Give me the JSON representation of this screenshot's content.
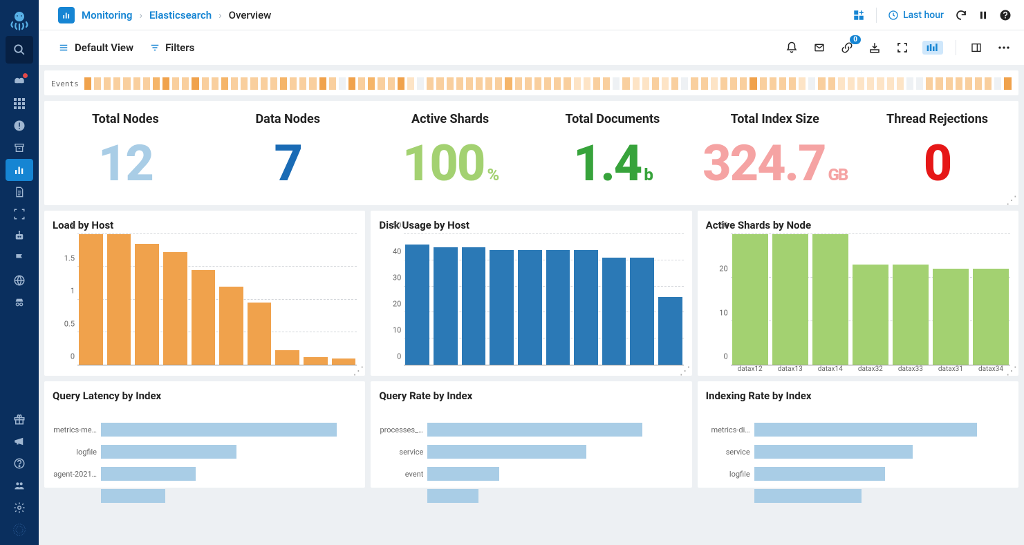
{
  "colors": {
    "accent": "#1685d3",
    "nav_bg": "#0a2f5e",
    "orange": "#f0a24c",
    "orange_light": "#f9cf9e",
    "blue_bar": "#2b79b6",
    "green_bar": "#a3d171",
    "hbar": "#a9cde6"
  },
  "breadcrumb": {
    "root": "Monitoring",
    "mid": "Elasticsearch",
    "leaf": "Overview"
  },
  "time_range": "Last hour",
  "toolbar": {
    "default_view": "Default View",
    "filters": "Filters",
    "token_badge": "0"
  },
  "events": {
    "label": "Events",
    "cells": [
      1.0,
      0.5,
      0.5,
      0.5,
      0.5,
      0.5,
      0.5,
      0.7,
      0.9,
      0.5,
      0.5,
      0.9,
      0.5,
      0.5,
      0.7,
      0.5,
      0.5,
      0.5,
      0.5,
      0.5,
      0.7,
      0.5,
      0.5,
      0.5,
      1.0,
      0.5,
      0.0,
      0.9,
      0.5,
      0.7,
      0.5,
      0.5,
      1.0,
      0.3,
      0.0,
      0.5,
      0.5,
      0.5,
      0.5,
      0.5,
      0.5,
      0.5,
      0.5,
      0.7,
      0.5,
      0.5,
      0.5,
      0.5,
      0.5,
      0.5,
      0.3,
      0.3,
      0.5,
      0.5,
      0.0,
      0.5,
      0.3,
      0.3,
      0.5,
      0.3,
      0.5,
      0.0,
      0.5,
      0.5,
      0.3,
      0.5,
      0.5,
      0.5,
      1.0,
      0.5,
      0.5,
      0.5,
      0.5,
      0.3,
      0.0,
      0.5,
      0.5,
      0.3,
      0.3,
      0.3,
      0.3,
      0.3,
      0.3,
      0.3,
      0.0,
      0.0,
      0.5,
      0.5,
      0.5,
      0.5,
      0.5,
      0.5,
      0.5,
      0.0,
      1.0
    ]
  },
  "metrics": [
    {
      "title": "Total Nodes",
      "value": "12",
      "unit": "",
      "class": "c-lightblue"
    },
    {
      "title": "Data Nodes",
      "value": "7",
      "unit": "",
      "class": "c-blue"
    },
    {
      "title": "Active Shards",
      "value": "100",
      "unit": "%",
      "class": "c-green"
    },
    {
      "title": "Total Documents",
      "value": "1.4",
      "unit": "b",
      "class": "c-darkgreen"
    },
    {
      "title": "Total Index Size",
      "value": "324.7",
      "unit": "GB",
      "class": "c-pink"
    },
    {
      "title": "Thread Rejections",
      "value": "0",
      "unit": "",
      "class": "c-red"
    }
  ],
  "chart_data": [
    {
      "id": "load-by-host",
      "title": "Load by Host",
      "type": "bar",
      "color": "#f0a24c",
      "ylim": [
        0,
        2
      ],
      "yticks": [
        0,
        0.5,
        1,
        1.5,
        2
      ],
      "categories": [
        "",
        "",
        "",
        "",
        "",
        "",
        "",
        "",
        "",
        ""
      ],
      "values": [
        2.0,
        2.0,
        1.85,
        1.72,
        1.45,
        1.2,
        0.95,
        0.22,
        0.12,
        0.1
      ]
    },
    {
      "id": "disk-usage-by-host",
      "title": "Disk Usage by Host",
      "type": "bar",
      "color": "#2b79b6",
      "ylim": [
        0,
        50
      ],
      "yticks": [
        0,
        10,
        20,
        30,
        40,
        50
      ],
      "categories": [
        "",
        "",
        "",
        "",
        "",
        "",
        "",
        "",
        "",
        ""
      ],
      "values": [
        46,
        45,
        45,
        44,
        44,
        44,
        44,
        41,
        41,
        26
      ]
    },
    {
      "id": "active-shards-by-node",
      "title": "Active Shards by Node",
      "type": "bar",
      "color": "#a3d171",
      "ylim": [
        0,
        30
      ],
      "yticks": [
        0,
        10,
        20,
        30
      ],
      "categories": [
        "datax12",
        "datax13",
        "datax14",
        "datax32",
        "datax33",
        "datax31",
        "datax34"
      ],
      "values": [
        30,
        30,
        30,
        23,
        23,
        22,
        22
      ]
    },
    {
      "id": "query-latency-by-index",
      "title": "Query Latency by Index",
      "type": "hbar",
      "color": "#a9cde6",
      "xlim": [
        0,
        100
      ],
      "categories": [
        "metrics-me…",
        "logfile",
        "agent-2021…",
        ""
      ],
      "values": [
        92,
        53,
        37,
        25
      ]
    },
    {
      "id": "query-rate-by-index",
      "title": "Query Rate by Index",
      "type": "hbar",
      "color": "#a9cde6",
      "xlim": [
        0,
        100
      ],
      "categories": [
        "processes_…",
        "service",
        "event",
        ""
      ],
      "values": [
        84,
        62,
        28,
        20
      ]
    },
    {
      "id": "indexing-rate-by-index",
      "title": "Indexing Rate by Index",
      "type": "hbar",
      "color": "#a9cde6",
      "xlim": [
        0,
        100
      ],
      "categories": [
        "metrics-di…",
        "service",
        "logfile",
        ""
      ],
      "values": [
        87,
        62,
        51,
        42
      ]
    }
  ]
}
